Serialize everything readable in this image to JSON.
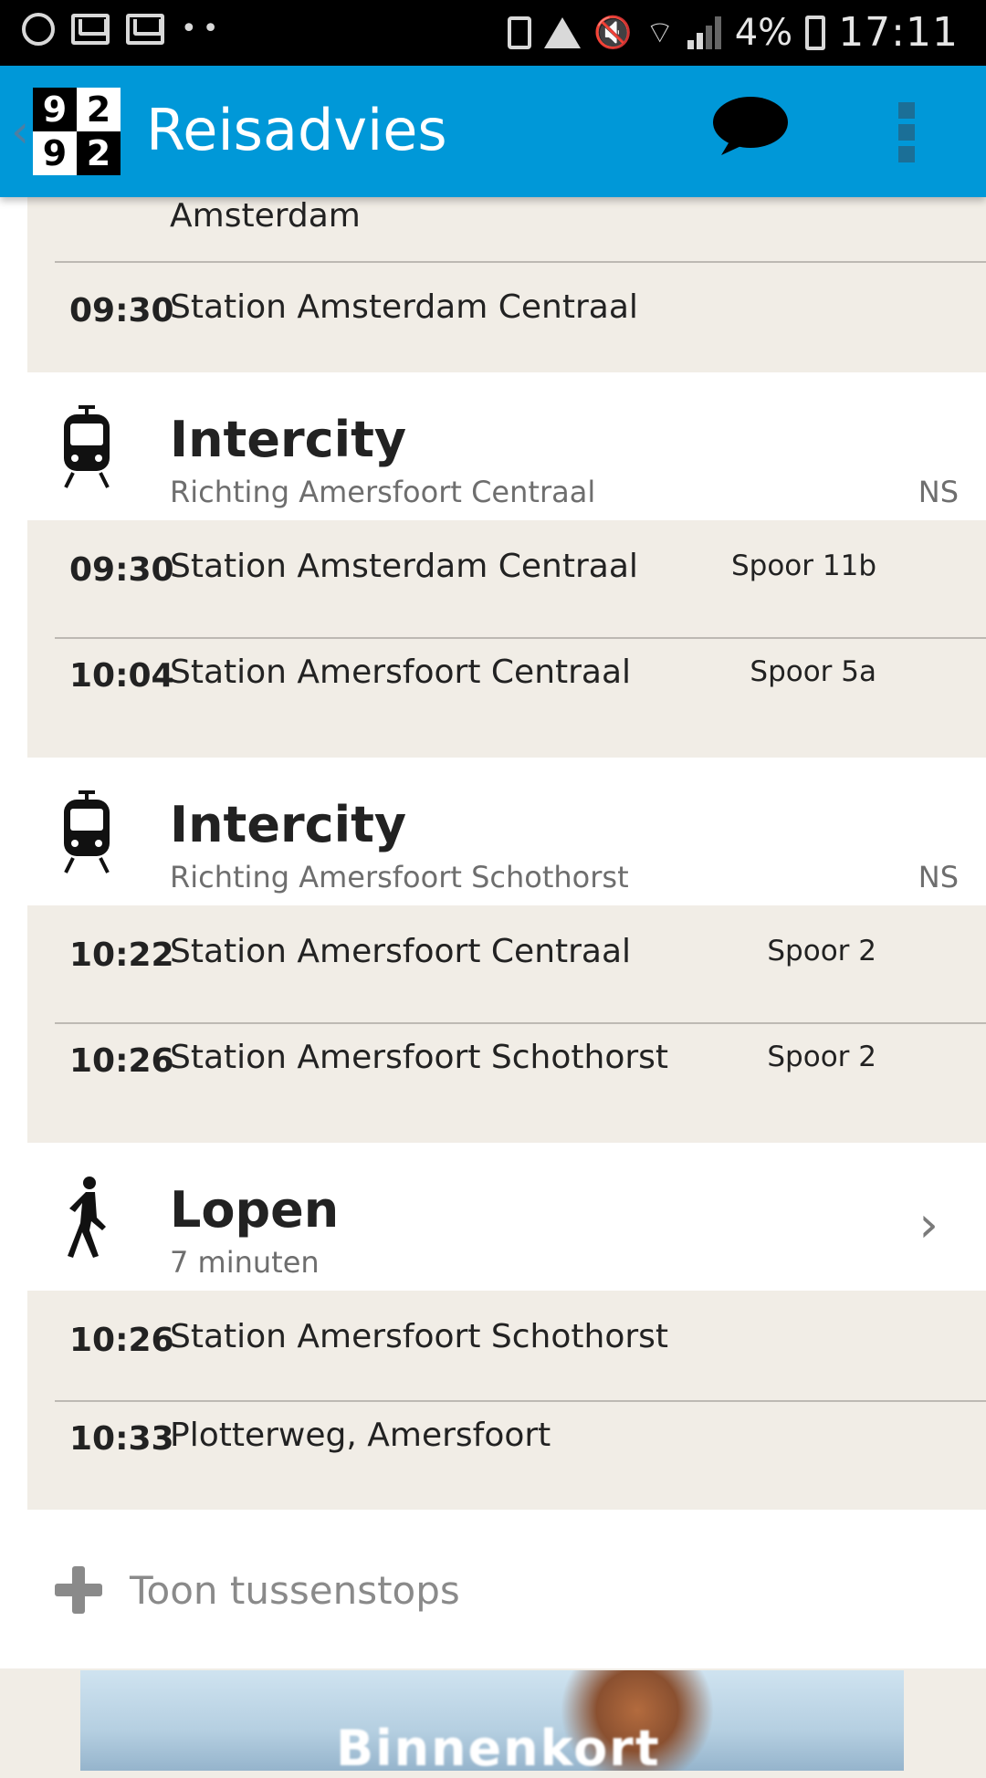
{
  "status_bar": {
    "battery_percent": "4%",
    "time": "17:11"
  },
  "app_bar": {
    "logo": [
      "9",
      "2",
      "9",
      "2"
    ],
    "title": "Reisadvies",
    "icons": [
      "chat-icon",
      "overflow-menu-icon"
    ],
    "accent_color": "#0098d8"
  },
  "top_section": {
    "partial_text": "Amsterdam",
    "row": {
      "time": "09:30",
      "station": "Station Amsterdam Centraal"
    }
  },
  "legs": [
    {
      "icon": "tram-icon",
      "title": "Intercity",
      "subtitle": "Richting Amersfoort Centraal",
      "operator": "NS",
      "stops": [
        {
          "time": "09:30",
          "station": "Station Amsterdam Centraal",
          "platform": "Spoor 11b"
        },
        {
          "time": "10:04",
          "station": "Station Amersfoort Centraal",
          "platform": "Spoor 5a"
        }
      ]
    },
    {
      "icon": "tram-icon",
      "title": "Intercity",
      "subtitle": "Richting Amersfoort Schothorst",
      "operator": "NS",
      "stops": [
        {
          "time": "10:22",
          "station": "Station Amersfoort Centraal",
          "platform": "Spoor 2"
        },
        {
          "time": "10:26",
          "station": "Station Amersfoort Schothorst",
          "platform": "Spoor 2"
        }
      ]
    },
    {
      "icon": "walking-icon",
      "title": "Lopen",
      "subtitle": "7 minuten",
      "stops": [
        {
          "time": "10:26",
          "station": "Station Amersfoort Schothorst"
        },
        {
          "time": "10:33",
          "station": "Plotterweg, Amersfoort"
        }
      ]
    }
  ],
  "toon_tussenstops": "Toon tussenstops",
  "banner_text": "Binnenkort"
}
